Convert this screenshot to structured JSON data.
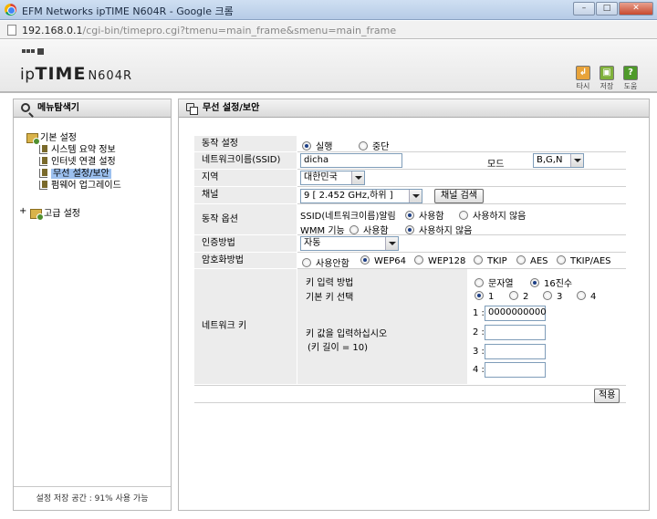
{
  "browser": {
    "window_title": "EFM Networks ipTIME N604R - Google 크롬",
    "url_host": "192.168.0.1",
    "url_path": "/cgi-bin/timepro.cgi?tmenu=main_frame&smenu=main_frame"
  },
  "header": {
    "brand_prefix": "ip",
    "brand_strong": "TIME",
    "brand_model": "N604R",
    "tools": [
      {
        "label": "타시",
        "icon": "return-icon",
        "color": "#e8a33a"
      },
      {
        "label": "저장",
        "icon": "save-icon",
        "color": "#7fb13a"
      },
      {
        "label": "도움",
        "icon": "help-icon",
        "color": "#4e9a2a"
      }
    ]
  },
  "left_panel": {
    "title": "메뉴탐색기",
    "groups": [
      {
        "label": "기본 설정",
        "items": [
          {
            "label": "시스템 요약 정보"
          },
          {
            "label": "인터넷 연결 설정"
          },
          {
            "label": "무선 설정/보안",
            "selected": true
          },
          {
            "label": "펌웨어 업그레이드"
          }
        ]
      },
      {
        "label": "고급 설정",
        "collapsed": true
      }
    ],
    "storage_status": "설정 저장 공간 : 91% 사용 가능"
  },
  "main_panel": {
    "title": "무선 설정/보안",
    "operation": {
      "label": "동작 설정",
      "options": [
        "실행",
        "중단"
      ],
      "selected": 0
    },
    "ssid": {
      "label": "네트워크이름(SSID)",
      "value": "dicha"
    },
    "mode": {
      "label": "모드",
      "value": "B,G,N"
    },
    "region": {
      "label": "지역",
      "value": "대한민국"
    },
    "channel": {
      "label": "채널",
      "value": "9 [ 2.452 GHz,하위 ]",
      "search_button": "채널 검색"
    },
    "options": {
      "label": "동작 옵션",
      "ssid_alert": {
        "label": "SSID(네트워크이름)알림",
        "options": [
          "사용함",
          "사용하지 않음"
        ],
        "selected": 0
      },
      "wmm": {
        "label": "WMM 기능",
        "options": [
          "사용함",
          "사용하지 않음"
        ],
        "selected": 1
      }
    },
    "auth": {
      "label": "인증방법",
      "value": "자동"
    },
    "encryption": {
      "label": "암호화방법",
      "options": [
        "사용안함",
        "WEP64",
        "WEP128",
        "TKIP",
        "AES",
        "TKIP/AES"
      ],
      "selected": 1
    },
    "network_key": {
      "label": "네트워크 키",
      "input_method": {
        "label": "키 입력 방법",
        "options": [
          "문자열",
          "16진수"
        ],
        "selected": 1
      },
      "default_key": {
        "label": "기본 키 선택",
        "options": [
          "1",
          "2",
          "3",
          "4"
        ],
        "selected": 0
      },
      "key_prompt": "키 값을 입력하십시오",
      "key_length_note": "(키 길이 = 10)",
      "keys": [
        {
          "label": "1 :",
          "value": "0000000000"
        },
        {
          "label": "2 :",
          "value": ""
        },
        {
          "label": "3 :",
          "value": ""
        },
        {
          "label": "4 :",
          "value": ""
        }
      ]
    },
    "apply_button": "적용"
  }
}
